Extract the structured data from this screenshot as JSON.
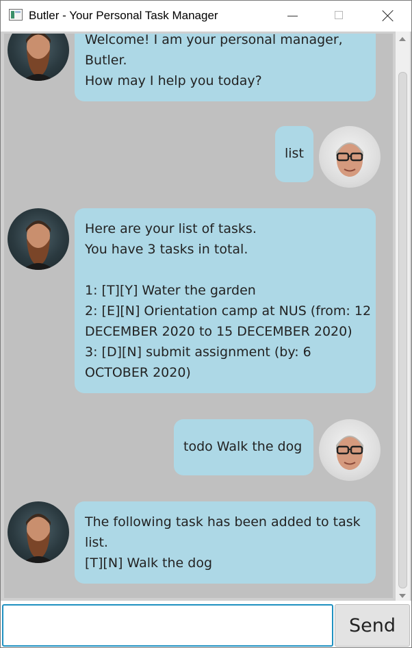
{
  "window": {
    "title": "Butler - Your Personal Task Manager"
  },
  "messages": [
    {
      "sender": "butler",
      "lines": [
        "Welcome! I am your personal manager,",
        "Butler.",
        "How may I help you today?"
      ]
    },
    {
      "sender": "user",
      "lines": [
        "list"
      ]
    },
    {
      "sender": "butler",
      "lines": [
        "Here are your list of tasks.",
        "You have 3 tasks in total.",
        "",
        "1: [T][Y] Water the garden",
        "2: [E][N] Orientation camp at NUS (from: 12",
        "DECEMBER 2020 to 15 DECEMBER 2020)",
        "3: [D][N] submit assignment (by: 6",
        "OCTOBER 2020)"
      ]
    },
    {
      "sender": "user",
      "lines": [
        "todo Walk the dog"
      ]
    },
    {
      "sender": "butler",
      "lines": [
        "The following task has been added to task",
        "list.",
        "[T][N] Walk the dog"
      ]
    }
  ],
  "input": {
    "value": "",
    "placeholder": ""
  },
  "send_button": {
    "label": "Send"
  },
  "colors": {
    "bubble": "#add8e6",
    "chat_background": "#c0c0c0",
    "input_focus_border": "#1e90c0"
  },
  "icons": {
    "app": "app-window-icon",
    "minimize": "minimize-icon",
    "maximize": "maximize-icon",
    "close": "close-icon",
    "butler_avatar": "bearded-man-avatar",
    "user_avatar": "man-with-glasses-avatar"
  }
}
